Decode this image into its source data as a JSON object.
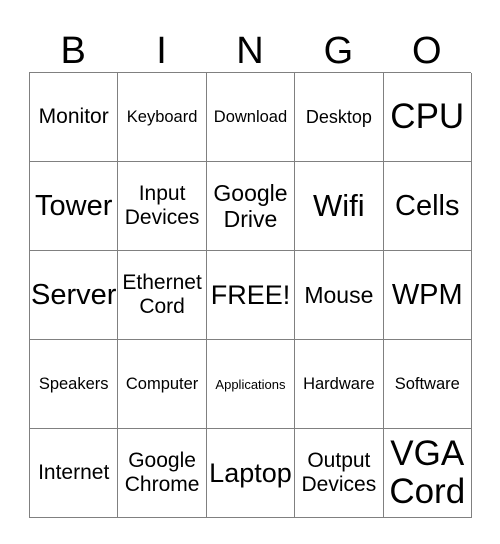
{
  "card": {
    "title": "BINGO",
    "header_letters": [
      "B",
      "I",
      "N",
      "G",
      "O"
    ],
    "free_space_label": "FREE!",
    "colors": {
      "text": "#000000",
      "grid_line": "#808080",
      "background": "#ffffff"
    },
    "rows": [
      [
        {
          "label": "Monitor",
          "size": "fs-m"
        },
        {
          "label": "Keyboard",
          "size": "fs-xs"
        },
        {
          "label": "Download",
          "size": "fs-xs"
        },
        {
          "label": "Desktop",
          "size": "fs-s"
        },
        {
          "label": "CPU",
          "size": "fs-huge"
        }
      ],
      [
        {
          "label": "Tower",
          "size": "fs-xl"
        },
        {
          "label": "Input\nDevices",
          "size": "fs-m"
        },
        {
          "label": "Google\nDrive",
          "size": "fs-ml"
        },
        {
          "label": "Wifi",
          "size": "fs-xxl"
        },
        {
          "label": "Cells",
          "size": "fs-xl"
        }
      ],
      [
        {
          "label": "Server",
          "size": "fs-xl"
        },
        {
          "label": "Ethernet\nCord",
          "size": "fs-m"
        },
        {
          "label": "FREE!",
          "size": "fs-l"
        },
        {
          "label": "Mouse",
          "size": "fs-ml"
        },
        {
          "label": "WPM",
          "size": "fs-xl"
        }
      ],
      [
        {
          "label": "Speakers",
          "size": "fs-xs"
        },
        {
          "label": "Computer",
          "size": "fs-xs"
        },
        {
          "label": "Applications",
          "size": "fs-xxs"
        },
        {
          "label": "Hardware",
          "size": "fs-xs"
        },
        {
          "label": "Software",
          "size": "fs-xs"
        }
      ],
      [
        {
          "label": "Internet",
          "size": "fs-m"
        },
        {
          "label": "Google\nChrome",
          "size": "fs-m"
        },
        {
          "label": "Laptop",
          "size": "fs-l"
        },
        {
          "label": "Output\nDevices",
          "size": "fs-m"
        },
        {
          "label": "VGA\nCord",
          "size": "fs-huge"
        }
      ]
    ]
  }
}
